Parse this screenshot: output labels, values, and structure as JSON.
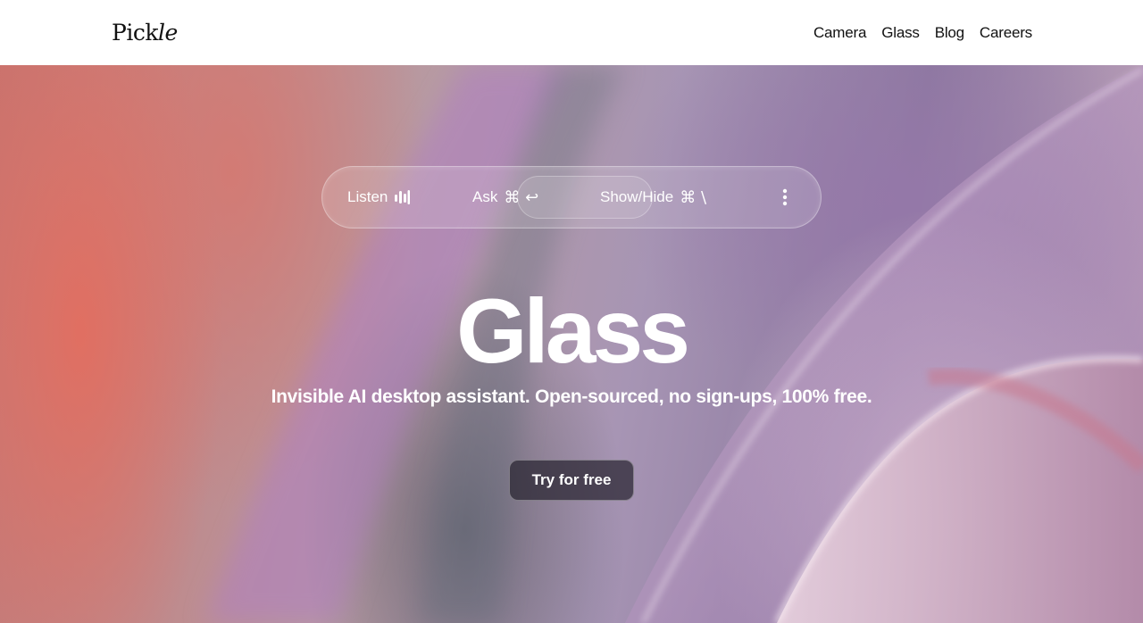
{
  "nav": {
    "logo": "Pickle",
    "links": [
      "Camera",
      "Glass",
      "Blog",
      "Careers"
    ]
  },
  "toolbar": {
    "listen_label": "Listen",
    "ask_label": "Ask",
    "ask_keys": "⌘ ↩",
    "show_hide_label": "Show/Hide",
    "show_hide_keys": "⌘ \\"
  },
  "hero": {
    "title": "Glass",
    "subtitle": "Invisible AI desktop assistant. Open-sourced, no sign-ups, 100% free.",
    "cta_label": "Try for free"
  },
  "icons": {
    "listen": "audio-bars-icon",
    "more": "more-vertical-icon"
  },
  "colors": {
    "nav_bg": "#ffffff",
    "text_dark": "#111111",
    "hero_text": "#ffffff"
  }
}
